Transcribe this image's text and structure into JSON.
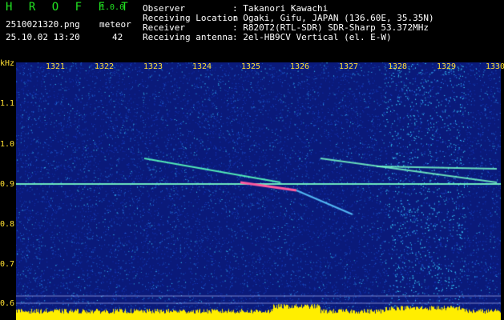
{
  "header": {
    "app_title": "H R O F F T",
    "app_version": "1.0.0",
    "file_name": "2510021320.png",
    "meteor_label": "meteor",
    "datetime": "25.10.02 13:20",
    "meteor_count": "42",
    "observer_label": "Observer",
    "observer_value": ": Takanori Kawachi",
    "location_label": "Receiving Location",
    "location_value": ": Ogaki, Gifu, JAPAN (136.60E, 35.35N)",
    "receiver_label": "Receiver",
    "receiver_value": ": R820T2(RTL-SDR) SDR-Sharp 53.372MHz",
    "antenna_label": "Receiving antenna",
    "antenna_value": ": 2el-HB9CV Vertical (el. E-W)"
  },
  "axes": {
    "y_unit": "kHz",
    "y_ticks": [
      "1.1",
      "1.0",
      "0.9",
      "0.8",
      "0.7",
      "0.6"
    ],
    "x_ticks": [
      "1321",
      "1322",
      "1323",
      "1324",
      "1325",
      "1326",
      "1327",
      "1328",
      "1329",
      "1330"
    ]
  },
  "colors": {
    "header_green": "#22e322",
    "label_yellow": "#ffe033",
    "background_blue": "#0a1a7a",
    "signal_band_blue": "#1f6fd6",
    "meteor_trail": "#ff5aa0",
    "level_bar_yellow": "#ffee00"
  }
}
